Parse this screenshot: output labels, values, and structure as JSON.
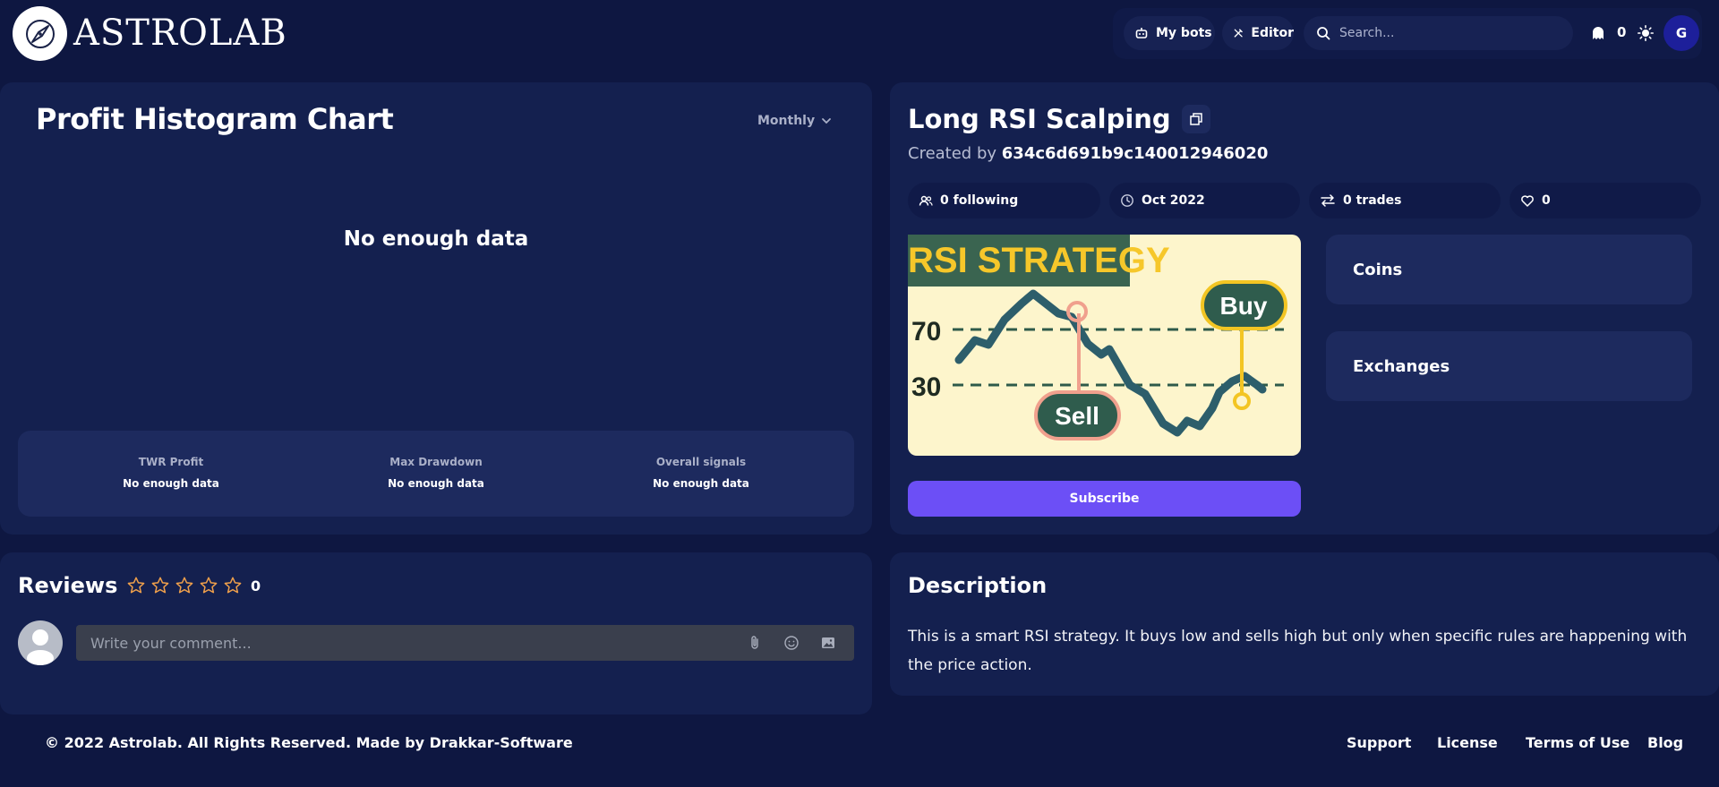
{
  "header": {
    "brand": "ASTROLAB",
    "my_bots": "My bots",
    "editor": "Editor",
    "search_placeholder": "Search...",
    "notifications_count": "0",
    "avatar_initial": "G"
  },
  "chart_card": {
    "title": "Profit Histogram Chart",
    "period": "Monthly",
    "empty_message": "No enough data",
    "stats": [
      {
        "label": "TWR Profit",
        "value": "No enough data"
      },
      {
        "label": "Max Drawdown",
        "value": "No enough data"
      },
      {
        "label": "Overall signals",
        "value": "No enough data"
      }
    ]
  },
  "strategy": {
    "title": "Long RSI Scalping",
    "created_by_label": "Created by",
    "creator": "634c6d691b9c140012946020",
    "following": "0 following",
    "date": "Oct 2022",
    "trades": "0 trades",
    "likes": "0",
    "image": {
      "banner": "RSI STRATEGY",
      "level_high": "70",
      "level_low": "30",
      "buy": "Buy",
      "sell": "Sell"
    },
    "coins_label": "Coins",
    "exchanges_label": "Exchanges",
    "subscribe_label": "Subscribe"
  },
  "reviews": {
    "title": "Reviews",
    "rating": 0,
    "count": "0",
    "comment_placeholder": "Write your comment..."
  },
  "description": {
    "title": "Description",
    "text": "This is a smart RSI strategy. It buys low and sells high but only when specific rules are happening with the price action."
  },
  "footer": {
    "copyright_prefix": "© 2022 Astrolab. All Rights Reserved. Made by ",
    "company": "Drakkar-Software",
    "links": [
      "Support",
      "License",
      "Terms of Use",
      "Blog"
    ]
  },
  "colors": {
    "background": "#0e1741",
    "card": "#14204f",
    "accent": "#6c4ff6",
    "star": "#f0a04b"
  }
}
